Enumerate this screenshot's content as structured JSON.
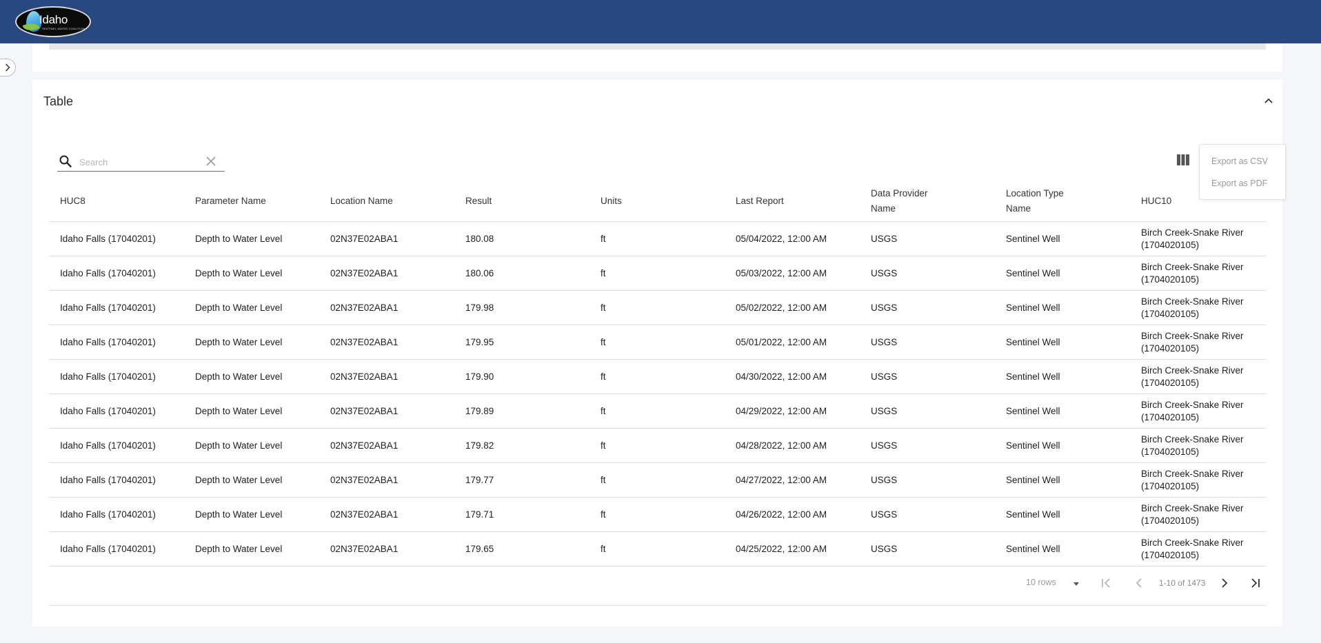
{
  "header": {
    "logo_text": "Idaho",
    "logo_tagline": "SENTINEL WATER COALITION"
  },
  "card": {
    "title": "Table"
  },
  "search": {
    "placeholder": "Search",
    "value": ""
  },
  "export_menu": {
    "csv_label": "Export as CSV",
    "pdf_label": "Export as PDF"
  },
  "table": {
    "columns": [
      {
        "line1": "HUC8",
        "line2": ""
      },
      {
        "line1": "Parameter Name",
        "line2": ""
      },
      {
        "line1": "Location Name",
        "line2": ""
      },
      {
        "line1": "Result",
        "line2": ""
      },
      {
        "line1": "Units",
        "line2": ""
      },
      {
        "line1": "Last Report",
        "line2": ""
      },
      {
        "line1": "Data Provider",
        "line2": "Name"
      },
      {
        "line1": "Location Type",
        "line2": "Name"
      },
      {
        "line1": "HUC10",
        "line2": ""
      }
    ],
    "rows": [
      [
        "Idaho Falls (17040201)",
        "Depth to Water Level",
        "02N37E02ABA1",
        "180.08",
        "ft",
        "05/04/2022, 12:00 AM",
        "USGS",
        "Sentinel Well",
        "Birch Creek-Snake River",
        "(1704020105)"
      ],
      [
        "Idaho Falls (17040201)",
        "Depth to Water Level",
        "02N37E02ABA1",
        "180.06",
        "ft",
        "05/03/2022, 12:00 AM",
        "USGS",
        "Sentinel Well",
        "Birch Creek-Snake River",
        "(1704020105)"
      ],
      [
        "Idaho Falls (17040201)",
        "Depth to Water Level",
        "02N37E02ABA1",
        "179.98",
        "ft",
        "05/02/2022, 12:00 AM",
        "USGS",
        "Sentinel Well",
        "Birch Creek-Snake River",
        "(1704020105)"
      ],
      [
        "Idaho Falls (17040201)",
        "Depth to Water Level",
        "02N37E02ABA1",
        "179.95",
        "ft",
        "05/01/2022, 12:00 AM",
        "USGS",
        "Sentinel Well",
        "Birch Creek-Snake River",
        "(1704020105)"
      ],
      [
        "Idaho Falls (17040201)",
        "Depth to Water Level",
        "02N37E02ABA1",
        "179.90",
        "ft",
        "04/30/2022, 12:00 AM",
        "USGS",
        "Sentinel Well",
        "Birch Creek-Snake River",
        "(1704020105)"
      ],
      [
        "Idaho Falls (17040201)",
        "Depth to Water Level",
        "02N37E02ABA1",
        "179.89",
        "ft",
        "04/29/2022, 12:00 AM",
        "USGS",
        "Sentinel Well",
        "Birch Creek-Snake River",
        "(1704020105)"
      ],
      [
        "Idaho Falls (17040201)",
        "Depth to Water Level",
        "02N37E02ABA1",
        "179.82",
        "ft",
        "04/28/2022, 12:00 AM",
        "USGS",
        "Sentinel Well",
        "Birch Creek-Snake River",
        "(1704020105)"
      ],
      [
        "Idaho Falls (17040201)",
        "Depth to Water Level",
        "02N37E02ABA1",
        "179.77",
        "ft",
        "04/27/2022, 12:00 AM",
        "USGS",
        "Sentinel Well",
        "Birch Creek-Snake River",
        "(1704020105)"
      ],
      [
        "Idaho Falls (17040201)",
        "Depth to Water Level",
        "02N37E02ABA1",
        "179.71",
        "ft",
        "04/26/2022, 12:00 AM",
        "USGS",
        "Sentinel Well",
        "Birch Creek-Snake River",
        "(1704020105)"
      ],
      [
        "Idaho Falls (17040201)",
        "Depth to Water Level",
        "02N37E02ABA1",
        "179.65",
        "ft",
        "04/25/2022, 12:00 AM",
        "USGS",
        "Sentinel Well",
        "Birch Creek-Snake River",
        "(1704020105)"
      ]
    ]
  },
  "pagination": {
    "rows_label": "10 rows",
    "range_label": "1-10 of 1473"
  },
  "colors": {
    "header_bg": "#28487f",
    "page_bg": "#f4f6f9",
    "card_bg": "#ffffff",
    "divider": "#dcdcdc"
  }
}
